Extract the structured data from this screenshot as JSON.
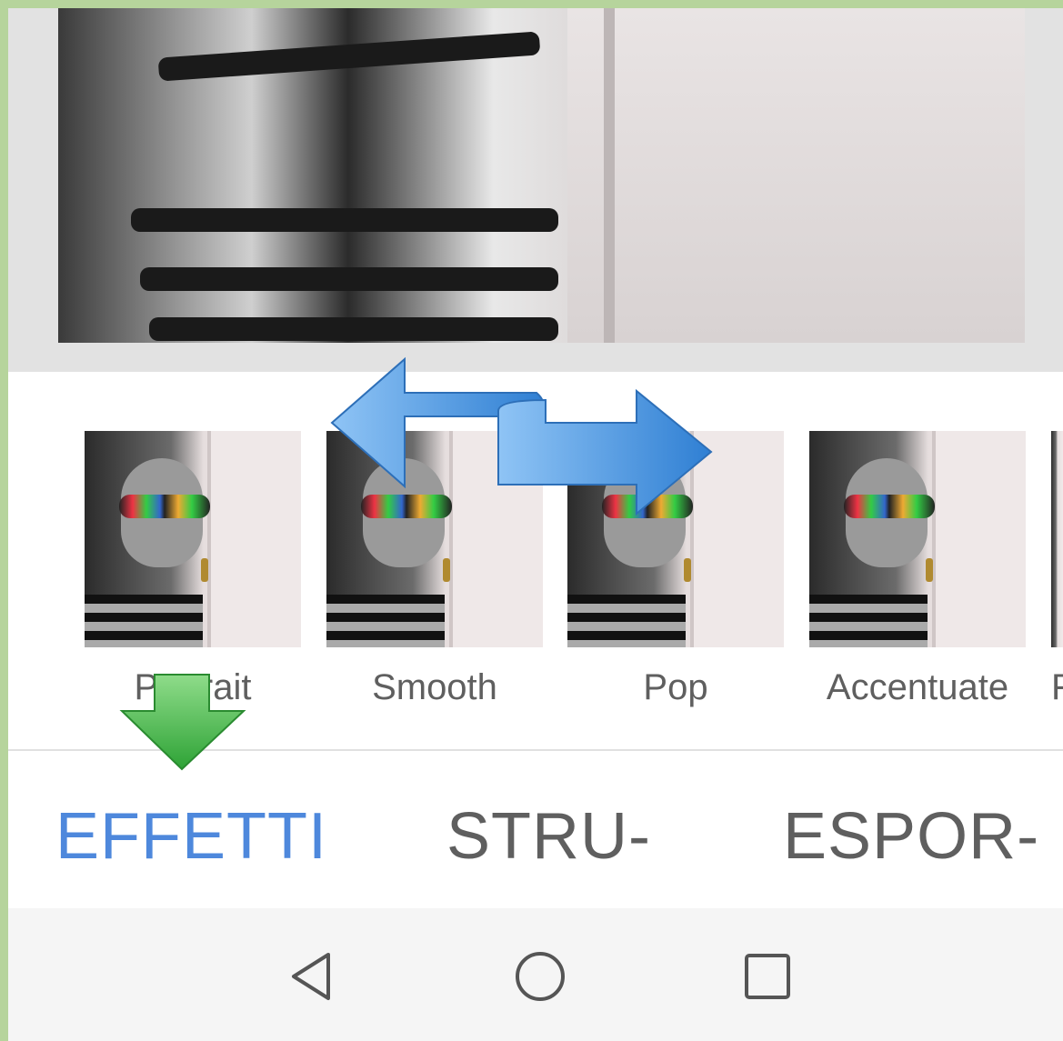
{
  "filters": [
    {
      "label": "Portrait"
    },
    {
      "label": "Smooth"
    },
    {
      "label": "Pop"
    },
    {
      "label": "Accentuate"
    },
    {
      "label": "F"
    }
  ],
  "tabs": {
    "effects": "EFFETTI",
    "tools": "STRU-",
    "export": "ESPOR-"
  },
  "navbar": {
    "back_icon": "back-triangle-icon",
    "home_icon": "home-circle-icon",
    "recents_icon": "recents-square-icon"
  },
  "colors": {
    "active_tab": "#4e88dc",
    "inactive_tab": "#5f5f5f",
    "frame_border": "#b6d49c",
    "swipe_arrow": "#4a90e2",
    "pointer_arrow": "#34a83a"
  }
}
